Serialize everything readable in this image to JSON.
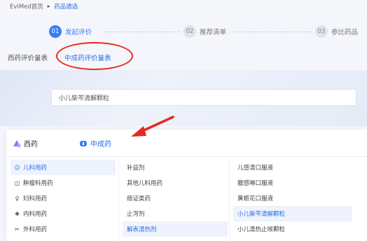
{
  "breadcrumb": {
    "home": "EviMed首页",
    "separator": "▸",
    "current": "药品遴选"
  },
  "steps": [
    {
      "num": "01",
      "label": "发起评价",
      "state": "active"
    },
    {
      "num": "02",
      "label": "推荐清单",
      "state": "inactive"
    },
    {
      "num": "03",
      "label": "参比药品",
      "state": "inactive"
    }
  ],
  "tabs": [
    {
      "label": "西药评价量表",
      "active": false
    },
    {
      "label": "中成药评价量表",
      "active": true
    }
  ],
  "search": {
    "value": "小儿柴芩清解颗粒",
    "placeholder": ""
  },
  "drug_types": {
    "western": "西药",
    "chinese": "中成药"
  },
  "categories": [
    {
      "icon": "☺",
      "icon_name": "child-icon",
      "label": "儿科用药",
      "selected": true
    },
    {
      "icon": "◫",
      "icon_name": "tumor-icon",
      "label": "肿瘤科用药",
      "selected": false
    },
    {
      "icon": "♀",
      "icon_name": "gynecology-icon",
      "label": "妇科用药",
      "selected": false
    },
    {
      "icon": "✚",
      "icon_name": "internal-medicine-icon",
      "label": "内科用药",
      "selected": false
    },
    {
      "icon": "✂",
      "icon_name": "surgery-icon",
      "label": "外科用药",
      "selected": false
    }
  ],
  "subcategories": [
    {
      "label": "补益剂",
      "selected": false
    },
    {
      "label": "其他儿科用药",
      "selected": false
    },
    {
      "label": "痞证类药",
      "selected": false
    },
    {
      "label": "止泻剂",
      "selected": false
    },
    {
      "label": "解表清热剂",
      "selected": true
    }
  ],
  "products": [
    {
      "label": "儿感清口服液",
      "selected": false
    },
    {
      "label": "馥感啉口服液",
      "selected": false
    },
    {
      "label": "黄栀花口服液",
      "selected": false
    },
    {
      "label": "小儿柴芩清解颗粒",
      "selected": true
    },
    {
      "label": "小儿清热止咳颗粒",
      "selected": false
    }
  ],
  "colors": {
    "accent": "#3d7cf2",
    "annotation_red": "#e8281c"
  }
}
